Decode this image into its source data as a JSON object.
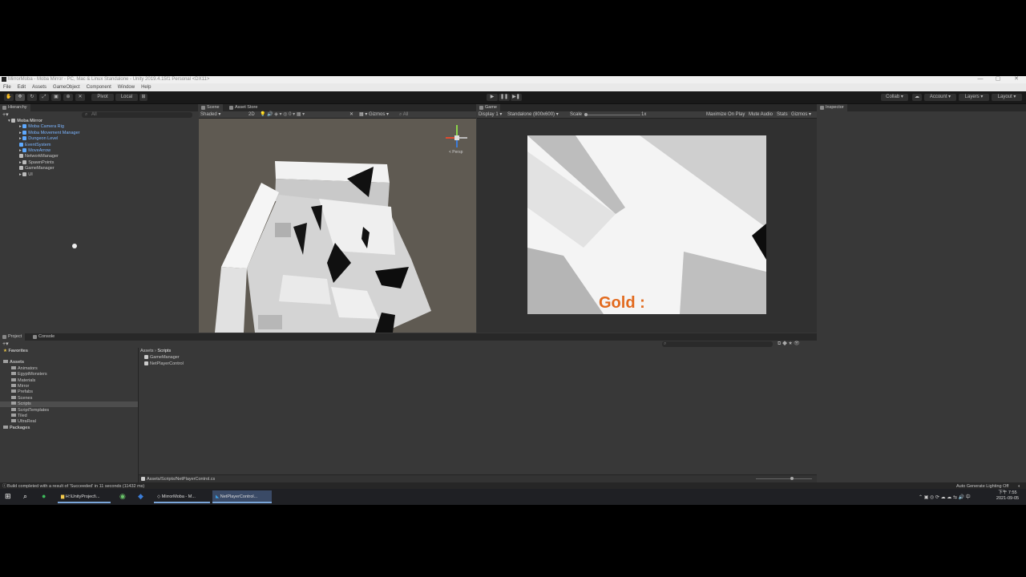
{
  "window": {
    "title": "MirrorMoba - Moba Mirror - PC, Mac & Linux Standalone - Unity 2019.4.15f1 Personal <DX11>",
    "min": "—",
    "max": "▢",
    "close": "✕"
  },
  "menu": [
    "File",
    "Edit",
    "Assets",
    "GameObject",
    "Component",
    "Window",
    "Help"
  ],
  "toolbar": {
    "pivot": "Pivot",
    "local": "Local",
    "collab": "Collab",
    "account": "Account",
    "layers": "Layers",
    "layout": "Layout"
  },
  "hierarchy": {
    "tab": "Hierarchy",
    "search_placeholder": "All",
    "items": [
      {
        "label": "Moba Mirror",
        "level": 0
      },
      {
        "label": "Moba Camera Rig",
        "level": 1
      },
      {
        "label": "Moba Movement Manager",
        "level": 1
      },
      {
        "label": "Dungeon Level",
        "level": 1
      },
      {
        "label": "EventSystem",
        "level": 1
      },
      {
        "label": "MoveArrow",
        "level": 1
      },
      {
        "label": "NetworkManager",
        "level": 1
      },
      {
        "label": "SpawnPoints",
        "level": 1
      },
      {
        "label": "GameManager",
        "level": 1
      },
      {
        "label": "UI",
        "level": 1
      }
    ]
  },
  "scene": {
    "tab_scene": "Scene",
    "tab_store": "Asset Store",
    "shading": "Shaded",
    "mode2d": "2D",
    "gizmos": "Gizmos",
    "gizmo_search": "All",
    "persp": "< Persp"
  },
  "game": {
    "tab": "Game",
    "display": "Display 1",
    "resolution": "Standalone (800x600)",
    "scale_label": "Scale",
    "scale_value": "1x",
    "maximize": "Maximize On Play",
    "mute": "Mute Audio",
    "stats": "Stats",
    "gizmos": "Gizmos",
    "gold_label": "Gold :"
  },
  "inspector": {
    "tab": "Inspector"
  },
  "project": {
    "tab_project": "Project",
    "tab_console": "Console",
    "favorites": "Favorites",
    "assets": "Assets",
    "folders": [
      "Animators",
      "EgyptMonsters",
      "Materials",
      "Mirror",
      "Prefabs",
      "Scenes",
      "Scripts",
      "ScriptTemplates",
      "Tiled",
      "UltraReal"
    ],
    "packages": "Packages",
    "breadcrumb": [
      "Assets",
      "Scripts"
    ],
    "files": [
      "GameManager",
      "NetPlayerControl"
    ],
    "selected_path": "Assets/Scripts/NetPlayerControl.cs"
  },
  "status": {
    "message": "Build completed with a result of 'Succeeded' in 11 seconds (11432 ms)",
    "lighting": "Auto Generate Lighting Off"
  },
  "taskbar": {
    "items": [
      "H:\\UnityProject\\...",
      "MirrorMoba - M...",
      "NetPlayerControl..."
    ],
    "time": "下午 7:55",
    "date": "2021-09-05"
  }
}
